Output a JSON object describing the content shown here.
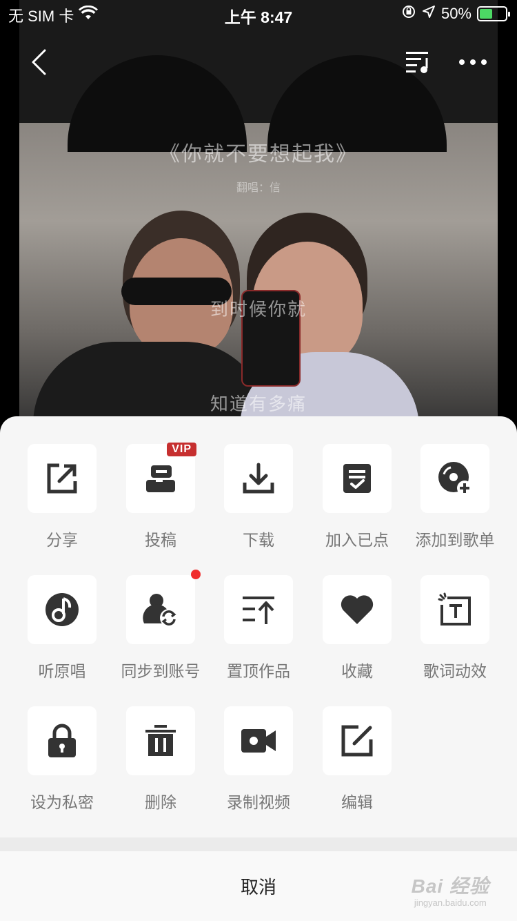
{
  "status_bar": {
    "carrier": "无 SIM 卡",
    "time": "上午 8:47",
    "battery": "50%",
    "battery_level": 0.5
  },
  "cover": {
    "title": "《你就不要想起我》",
    "subtitle": "翻唱：信",
    "lyric_line1": "到时候你就",
    "lyric_line2": "知道有多痛"
  },
  "actions": [
    {
      "label": "分享",
      "icon": "share-icon"
    },
    {
      "label": "投稿",
      "icon": "submit-icon",
      "badge": "VIP"
    },
    {
      "label": "下载",
      "icon": "download-icon"
    },
    {
      "label": "加入已点",
      "icon": "add-to-queue-icon"
    },
    {
      "label": "添加到歌单",
      "icon": "add-to-playlist-icon"
    },
    {
      "label": "听原唱",
      "icon": "original-song-icon"
    },
    {
      "label": "同步到账号",
      "icon": "sync-account-icon"
    },
    {
      "label": "置顶作品",
      "icon": "pin-top-icon"
    },
    {
      "label": "收藏",
      "icon": "heart-icon"
    },
    {
      "label": "歌词动效",
      "icon": "lyric-effect-icon"
    },
    {
      "label": "设为私密",
      "icon": "lock-icon"
    },
    {
      "label": "删除",
      "icon": "trash-icon"
    },
    {
      "label": "录制视频",
      "icon": "video-camera-icon"
    },
    {
      "label": "编辑",
      "icon": "edit-icon"
    }
  ],
  "cancel_label": "取消",
  "colors": {
    "accent_red": "#c62f2f",
    "icon_dark": "#333333",
    "sheet_bg": "#f6f6f6"
  },
  "watermark": {
    "brand": "Bai 经验",
    "url": "jingyan.baidu.com"
  }
}
